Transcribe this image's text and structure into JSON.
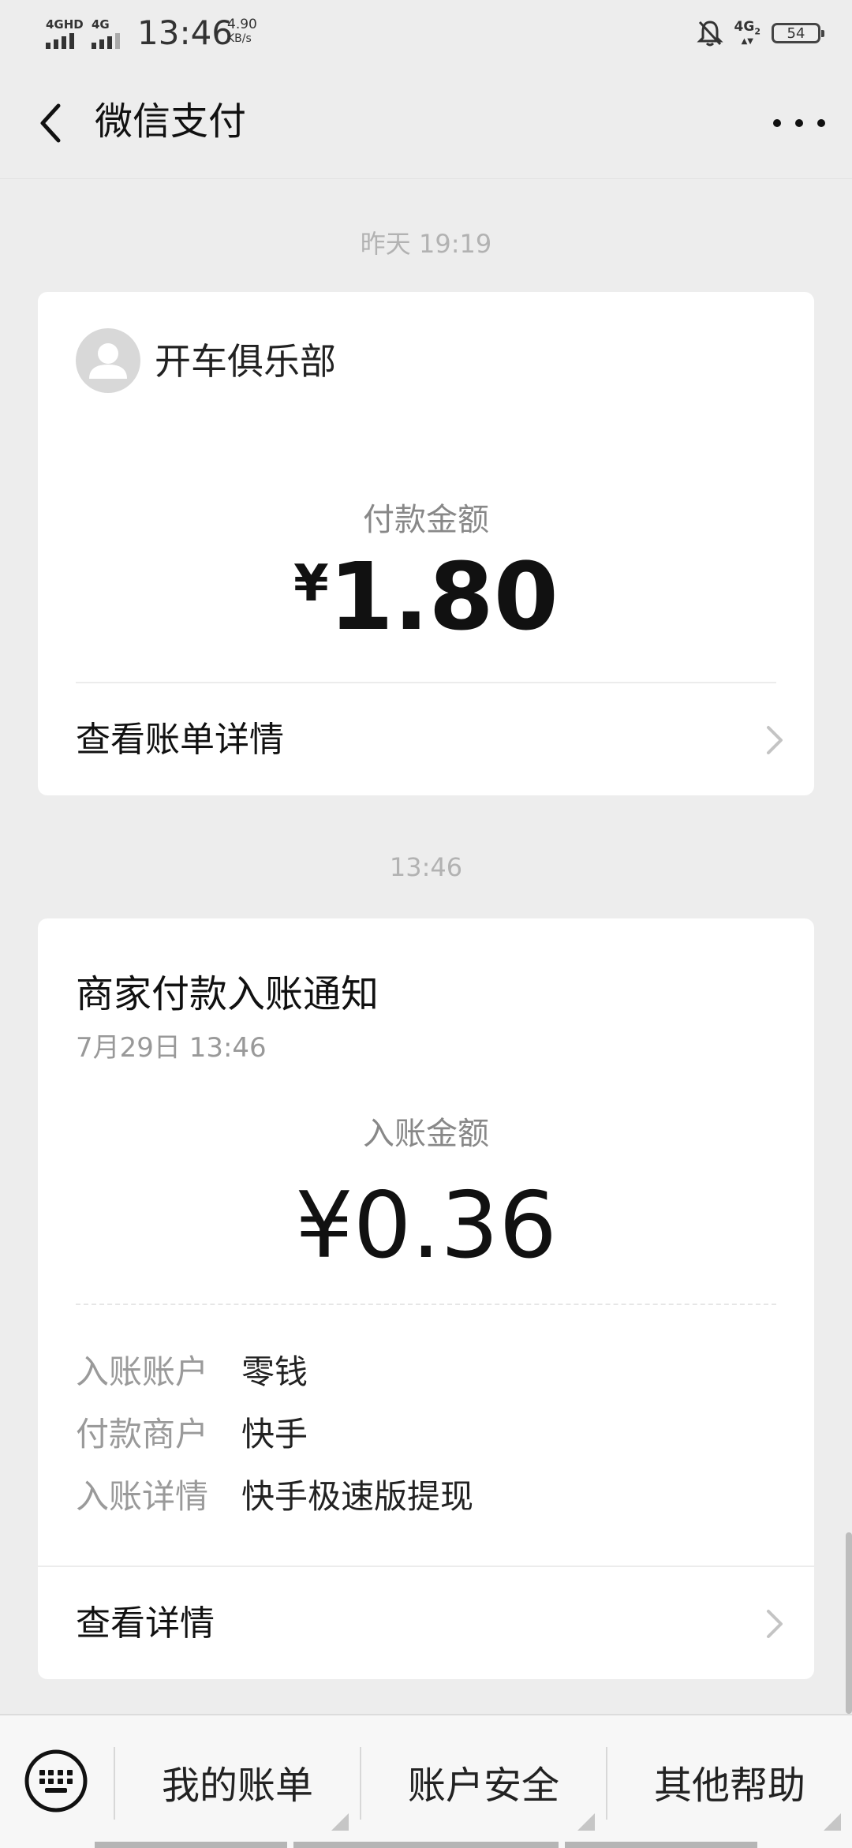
{
  "status_bar": {
    "sim1": "4GHD",
    "sim2": "4G",
    "time": "13:46",
    "speed_value": "4.90",
    "speed_unit": "KB/s",
    "network_right": "4G",
    "network_sub": "2",
    "battery": "54"
  },
  "nav": {
    "title": "微信支付",
    "back_icon": "chevron-left-icon",
    "more_icon": "ellipsis-icon"
  },
  "messages": [
    {
      "time": "昨天 19:19",
      "merchant": "开车俱乐部",
      "amount_label": "付款金额",
      "currency": "¥",
      "amount": "1.80",
      "link": "查看账单详情"
    },
    {
      "time": "13:46",
      "title": "商家付款入账通知",
      "datetime": "7月29日  13:46",
      "amount_label": "入账金额",
      "amount": "¥0.36",
      "details": [
        {
          "key": "入账账户",
          "value": "零钱"
        },
        {
          "key": "付款商户",
          "value": "快手"
        },
        {
          "key": "入账详情",
          "value": "快手极速版提现"
        }
      ],
      "link": "查看详情"
    }
  ],
  "bottom_menu": {
    "keyboard_icon": "keyboard-icon",
    "items": [
      "我的账单",
      "账户安全",
      "其他帮助"
    ]
  },
  "colors": {
    "background": "#ededed",
    "card": "#ffffff",
    "muted_text": "#999999"
  }
}
